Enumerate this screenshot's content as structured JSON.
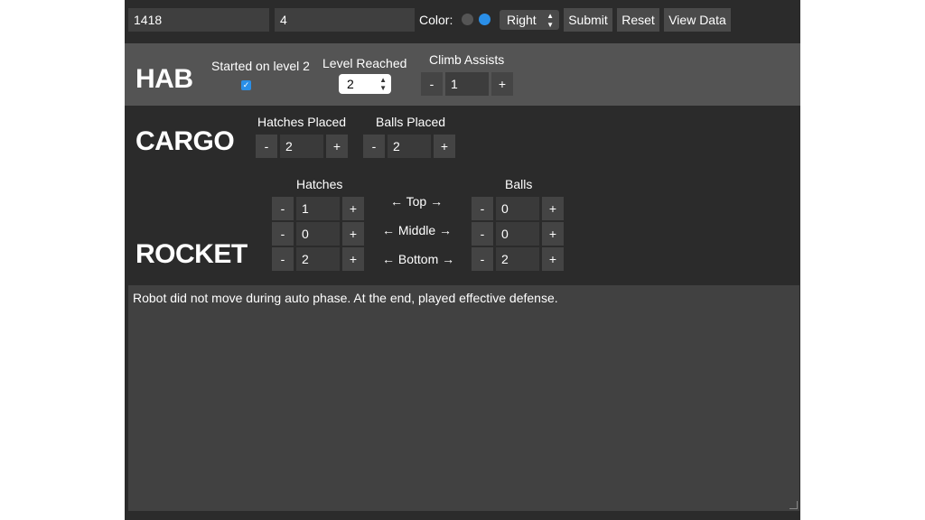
{
  "top": {
    "team": "1418",
    "match": "4",
    "color_label": "Color:",
    "side": "Right",
    "submit": "Submit",
    "reset": "Reset",
    "view_data": "View Data"
  },
  "hab": {
    "title": "HAB",
    "started_label": "Started on level 2",
    "started_checked": true,
    "level_label": "Level Reached",
    "level_value": "2",
    "climb_label": "Climb Assists",
    "climb_value": "1"
  },
  "cargo": {
    "title": "CARGO",
    "hatches_label": "Hatches Placed",
    "hatches_value": "2",
    "balls_label": "Balls Placed",
    "balls_value": "2"
  },
  "rocket": {
    "title": "ROCKET",
    "hatches_header": "Hatches",
    "balls_header": "Balls",
    "rows": [
      {
        "label": "← Top →",
        "hatches": "1",
        "balls": "0"
      },
      {
        "label": "← Middle →",
        "hatches": "0",
        "balls": "0"
      },
      {
        "label": "← Bottom →",
        "hatches": "2",
        "balls": "2"
      }
    ]
  },
  "notes": "Robot did not move during auto phase. At the end, played effective defense.",
  "stepper": {
    "minus": "-",
    "plus": "+"
  },
  "colors": {
    "accent": "#2a8fe8",
    "background": "#2b2b2b",
    "hab_band": "#545454"
  }
}
